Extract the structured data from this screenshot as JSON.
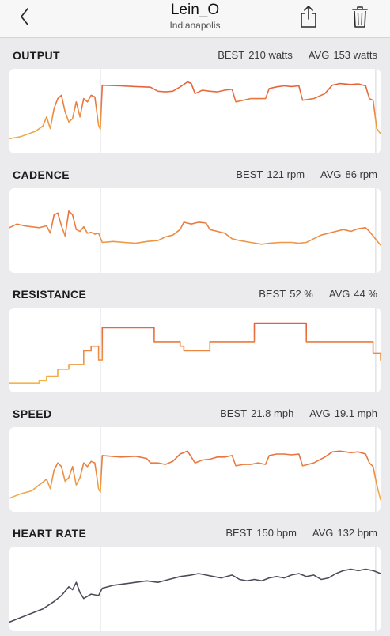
{
  "header": {
    "title": "Lein_O",
    "subtitle": "Indianapolis",
    "back_icon": "chevron-left-icon",
    "share_icon": "share-icon",
    "delete_icon": "trash-icon"
  },
  "colors": {
    "background": "#ebebed",
    "chart_bg": "#ffffff",
    "gradient_low": "#f6c24a",
    "gradient_high": "#e24a38",
    "heart_rate_line": "#4a4c5a",
    "marker_line": "#d6d6da"
  },
  "sections": [
    {
      "key": "output",
      "title": "OUTPUT",
      "best_label": "BEST",
      "best_value": "210 watts",
      "avg_label": "AVG",
      "avg_value": "153 watts"
    },
    {
      "key": "cadence",
      "title": "CADENCE",
      "best_label": "BEST",
      "best_value": "121 rpm",
      "avg_label": "AVG",
      "avg_value": "86 rpm"
    },
    {
      "key": "resistance",
      "title": "RESISTANCE",
      "best_label": "BEST",
      "best_value": "52 %",
      "avg_label": "AVG",
      "avg_value": "44 %"
    },
    {
      "key": "speed",
      "title": "SPEED",
      "best_label": "BEST",
      "best_value": "21.8 mph",
      "avg_label": "AVG",
      "avg_value": "19.1 mph"
    },
    {
      "key": "heart_rate",
      "title": "HEART RATE",
      "best_label": "BEST",
      "best_value": "150 bpm",
      "avg_label": "AVG",
      "avg_value": "132 bpm"
    }
  ],
  "chart_data": [
    {
      "type": "line",
      "name": "output",
      "color_mode": "gradient",
      "ylim": [
        0,
        220
      ],
      "x_range": [
        0,
        100
      ],
      "markers": [
        24.5,
        98.7
      ],
      "points": [
        [
          0,
          30
        ],
        [
          3,
          36
        ],
        [
          5,
          44
        ],
        [
          7,
          52
        ],
        [
          9,
          68
        ],
        [
          10,
          95
        ],
        [
          11,
          60
        ],
        [
          12,
          120
        ],
        [
          13,
          150
        ],
        [
          14,
          160
        ],
        [
          15,
          110
        ],
        [
          16,
          80
        ],
        [
          17,
          90
        ],
        [
          18,
          140
        ],
        [
          19,
          95
        ],
        [
          20,
          150
        ],
        [
          21,
          140
        ],
        [
          22,
          160
        ],
        [
          23,
          155
        ],
        [
          24,
          70
        ],
        [
          24.5,
          58
        ],
        [
          25,
          190
        ],
        [
          30,
          188
        ],
        [
          34,
          186
        ],
        [
          38,
          184
        ],
        [
          40,
          172
        ],
        [
          42,
          170
        ],
        [
          44,
          172
        ],
        [
          46,
          185
        ],
        [
          48,
          200
        ],
        [
          49,
          195
        ],
        [
          50,
          165
        ],
        [
          52,
          175
        ],
        [
          54,
          172
        ],
        [
          56,
          170
        ],
        [
          58,
          175
        ],
        [
          60,
          178
        ],
        [
          61,
          140
        ],
        [
          63,
          145
        ],
        [
          65,
          150
        ],
        [
          67,
          150
        ],
        [
          69,
          150
        ],
        [
          70,
          180
        ],
        [
          72,
          185
        ],
        [
          74,
          188
        ],
        [
          76,
          186
        ],
        [
          78,
          188
        ],
        [
          79,
          145
        ],
        [
          82,
          150
        ],
        [
          85,
          165
        ],
        [
          87,
          190
        ],
        [
          89,
          195
        ],
        [
          92,
          192
        ],
        [
          94,
          194
        ],
        [
          96,
          188
        ],
        [
          97,
          150
        ],
        [
          98,
          145
        ],
        [
          99,
          60
        ],
        [
          100,
          45
        ]
      ]
    },
    {
      "type": "line",
      "name": "cadence",
      "color_mode": "gradient",
      "ylim": [
        50,
        130
      ],
      "x_range": [
        0,
        100
      ],
      "markers": [
        24.5,
        98.7
      ],
      "points": [
        [
          0,
          94
        ],
        [
          2,
          98
        ],
        [
          4,
          96
        ],
        [
          6,
          95
        ],
        [
          8,
          94
        ],
        [
          10,
          96
        ],
        [
          11,
          88
        ],
        [
          12,
          108
        ],
        [
          13,
          110
        ],
        [
          14,
          96
        ],
        [
          15,
          85
        ],
        [
          16,
          112
        ],
        [
          17,
          108
        ],
        [
          18,
          92
        ],
        [
          19,
          90
        ],
        [
          20,
          95
        ],
        [
          21,
          88
        ],
        [
          22,
          89
        ],
        [
          23,
          87
        ],
        [
          24,
          88
        ],
        [
          25,
          78
        ],
        [
          28,
          79
        ],
        [
          31,
          78
        ],
        [
          34,
          77
        ],
        [
          37,
          79
        ],
        [
          40,
          80
        ],
        [
          42,
          84
        ],
        [
          44,
          86
        ],
        [
          46,
          92
        ],
        [
          47,
          100
        ],
        [
          49,
          98
        ],
        [
          51,
          100
        ],
        [
          53,
          99
        ],
        [
          54,
          92
        ],
        [
          56,
          90
        ],
        [
          58,
          88
        ],
        [
          60,
          82
        ],
        [
          62,
          80
        ],
        [
          65,
          78
        ],
        [
          68,
          76
        ],
        [
          70,
          77
        ],
        [
          73,
          78
        ],
        [
          76,
          78
        ],
        [
          78,
          77
        ],
        [
          80,
          78
        ],
        [
          82,
          82
        ],
        [
          84,
          86
        ],
        [
          86,
          88
        ],
        [
          88,
          90
        ],
        [
          90,
          92
        ],
        [
          92,
          90
        ],
        [
          94,
          93
        ],
        [
          96,
          94
        ],
        [
          97,
          90
        ],
        [
          98,
          85
        ],
        [
          99,
          80
        ],
        [
          100,
          75
        ]
      ]
    },
    {
      "type": "step",
      "name": "resistance",
      "color_mode": "gradient",
      "ylim": [
        28,
        60
      ],
      "x_range": [
        0,
        100
      ],
      "markers": [
        24.5,
        98.7
      ],
      "points": [
        [
          0,
          30
        ],
        [
          8,
          31
        ],
        [
          10,
          33
        ],
        [
          13,
          36
        ],
        [
          16,
          38
        ],
        [
          20,
          44
        ],
        [
          22,
          46
        ],
        [
          24,
          40
        ],
        [
          25,
          54
        ],
        [
          38,
          54
        ],
        [
          39,
          48
        ],
        [
          45,
          48
        ],
        [
          46,
          46
        ],
        [
          47,
          44
        ],
        [
          53,
          44
        ],
        [
          54,
          48
        ],
        [
          65,
          48
        ],
        [
          66,
          56
        ],
        [
          79,
          56
        ],
        [
          80,
          48
        ],
        [
          87,
          48
        ],
        [
          88,
          48
        ],
        [
          97,
          48
        ],
        [
          98,
          43
        ],
        [
          100,
          40
        ]
      ]
    },
    {
      "type": "line",
      "name": "speed",
      "color_mode": "gradient",
      "ylim": [
        14,
        24
      ],
      "x_range": [
        0,
        100
      ],
      "markers": [
        24.5,
        98.7
      ],
      "points": [
        [
          0,
          15.2
        ],
        [
          3,
          15.8
        ],
        [
          6,
          16.2
        ],
        [
          8,
          17.0
        ],
        [
          10,
          17.8
        ],
        [
          11,
          16.5
        ],
        [
          12,
          19.0
        ],
        [
          13,
          20.0
        ],
        [
          14,
          19.5
        ],
        [
          15,
          17.5
        ],
        [
          16,
          18.0
        ],
        [
          17,
          19.5
        ],
        [
          18,
          17.0
        ],
        [
          19,
          18.0
        ],
        [
          20,
          20.0
        ],
        [
          21,
          19.5
        ],
        [
          22,
          20.2
        ],
        [
          23,
          20.0
        ],
        [
          24,
          16.5
        ],
        [
          24.5,
          16.0
        ],
        [
          25,
          21.0
        ],
        [
          30,
          20.8
        ],
        [
          34,
          20.9
        ],
        [
          37,
          20.6
        ],
        [
          38,
          20.0
        ],
        [
          40,
          20.0
        ],
        [
          42,
          19.8
        ],
        [
          44,
          20.2
        ],
        [
          46,
          21.2
        ],
        [
          48,
          21.6
        ],
        [
          50,
          20.0
        ],
        [
          52,
          20.4
        ],
        [
          54,
          20.5
        ],
        [
          56,
          20.8
        ],
        [
          58,
          20.8
        ],
        [
          60,
          21.0
        ],
        [
          61,
          19.6
        ],
        [
          63,
          19.8
        ],
        [
          65,
          19.8
        ],
        [
          67,
          20.0
        ],
        [
          69,
          19.8
        ],
        [
          70,
          21.0
        ],
        [
          72,
          21.2
        ],
        [
          74,
          21.2
        ],
        [
          76,
          21.1
        ],
        [
          78,
          21.2
        ],
        [
          79,
          19.6
        ],
        [
          82,
          20.0
        ],
        [
          85,
          20.8
        ],
        [
          87,
          21.5
        ],
        [
          89,
          21.6
        ],
        [
          92,
          21.4
        ],
        [
          94,
          21.5
        ],
        [
          96,
          21.2
        ],
        [
          97,
          20.0
        ],
        [
          98,
          19.5
        ],
        [
          99,
          17.0
        ],
        [
          100,
          15.0
        ]
      ]
    },
    {
      "type": "line",
      "name": "heart_rate",
      "color_mode": "solid",
      "ylim": [
        105,
        155
      ],
      "x_range": [
        0,
        100
      ],
      "markers": [
        24.5,
        98.7
      ],
      "points": [
        [
          0,
          108
        ],
        [
          3,
          111
        ],
        [
          6,
          114
        ],
        [
          9,
          117
        ],
        [
          12,
          122
        ],
        [
          14,
          126
        ],
        [
          16,
          132
        ],
        [
          17,
          130
        ],
        [
          18,
          135
        ],
        [
          19,
          128
        ],
        [
          20,
          124
        ],
        [
          22,
          127
        ],
        [
          24,
          126
        ],
        [
          25,
          131
        ],
        [
          28,
          133
        ],
        [
          31,
          134
        ],
        [
          34,
          135
        ],
        [
          37,
          136
        ],
        [
          40,
          135
        ],
        [
          43,
          137
        ],
        [
          46,
          139
        ],
        [
          49,
          140
        ],
        [
          51,
          141
        ],
        [
          53,
          140
        ],
        [
          55,
          139
        ],
        [
          57,
          138
        ],
        [
          60,
          140
        ],
        [
          62,
          137
        ],
        [
          64,
          136
        ],
        [
          66,
          137
        ],
        [
          68,
          136
        ],
        [
          70,
          138
        ],
        [
          72,
          139
        ],
        [
          74,
          138
        ],
        [
          76,
          140
        ],
        [
          78,
          141
        ],
        [
          80,
          139
        ],
        [
          82,
          140
        ],
        [
          84,
          137
        ],
        [
          86,
          138
        ],
        [
          88,
          141
        ],
        [
          90,
          143
        ],
        [
          92,
          144
        ],
        [
          94,
          143
        ],
        [
          96,
          144
        ],
        [
          98,
          143
        ],
        [
          100,
          141
        ]
      ]
    }
  ]
}
